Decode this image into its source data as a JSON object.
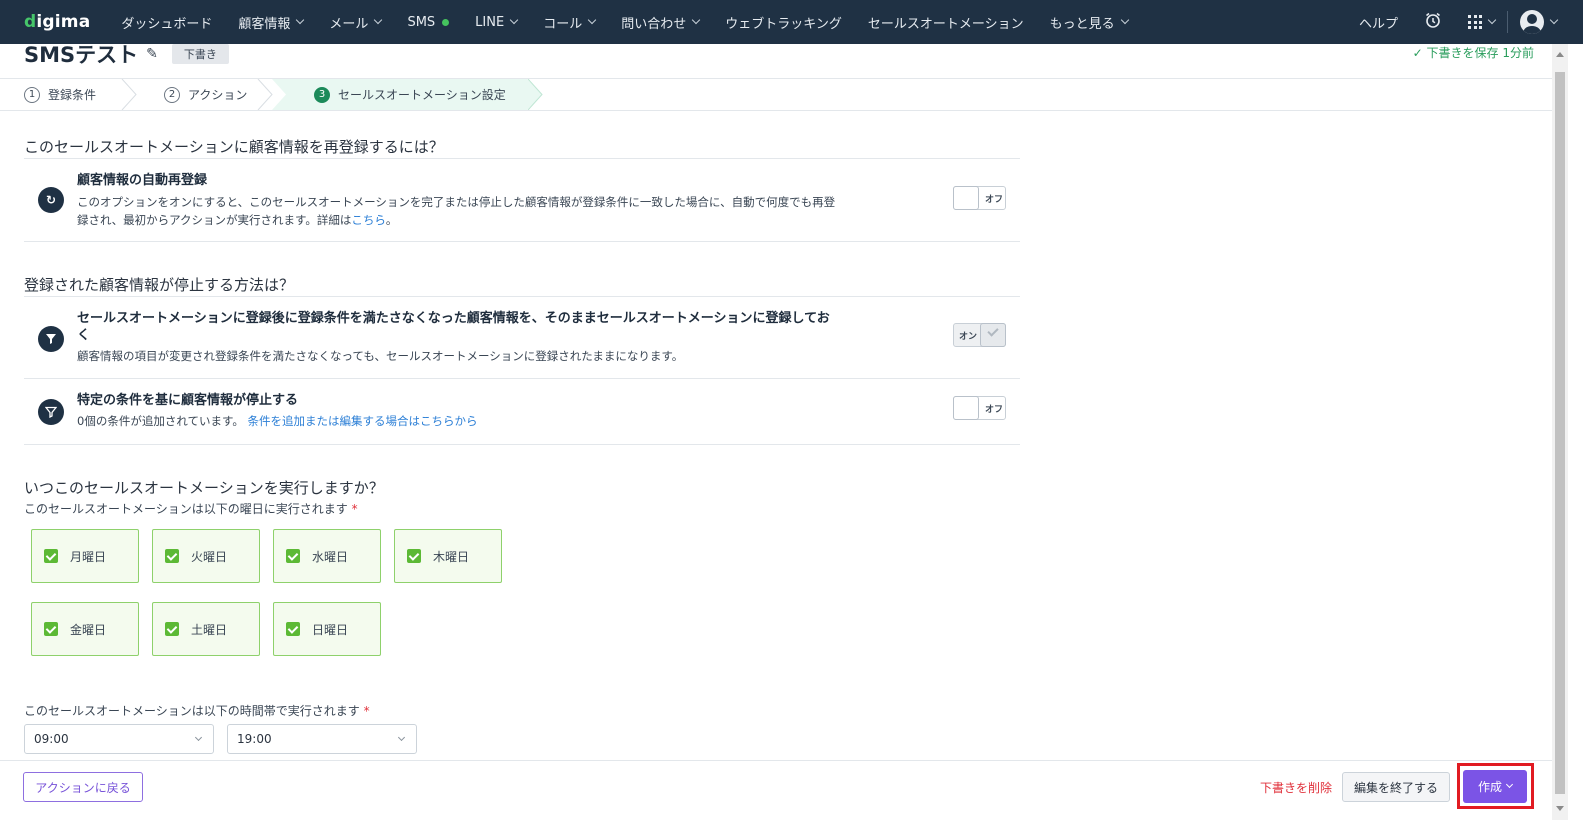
{
  "nav": {
    "logo_d": "d",
    "logo_rest": "igima",
    "items": [
      "ダッシュボード",
      "顧客情報",
      "メール",
      "SMS",
      "LINE",
      "コール",
      "問い合わせ",
      "ウェブトラッキング",
      "セールスオートメーション",
      "もっと見る"
    ],
    "help": "ヘルプ"
  },
  "header": {
    "title": "SMSテスト",
    "badge": "下書き",
    "saved": "✓ 下書きを保存 1分前"
  },
  "steps": [
    {
      "num": "1",
      "label": "登録条件"
    },
    {
      "num": "2",
      "label": "アクション"
    },
    {
      "num": "3",
      "label": "セールスオートメーション設定"
    }
  ],
  "sections": {
    "re_register": {
      "heading": "このセールスオートメーションに顧客情報を再登録するには？",
      "title": "顧客情報の自動再登録",
      "desc": "このオプションをオンにすると、このセールスオートメーションを完了または停止した顧客情報が登録条件に一致した場合に、自動で何度でも再登録され、最初からアクションが実行されます。詳細は",
      "link": "こちら",
      "desc_end": "。",
      "toggle": "オフ"
    },
    "stop": {
      "heading": "登録された顧客情報が停止する方法は？",
      "opt1_title": "セールスオートメーションに登録後に登録条件を満たさなくなった顧客情報を、そのままセールスオートメーションに登録しておく",
      "opt1_desc": "顧客情報の項目が変更され登録条件を満たさなくなっても、セールスオートメーションに登録されたままになります。",
      "opt1_toggle": "オン",
      "opt2_title": "特定の条件を基に顧客情報が停止する",
      "opt2_desc": "0個の条件が追加されています。",
      "opt2_link": "条件を追加または編集する場合はこちらから",
      "opt2_toggle": "オフ"
    },
    "schedule": {
      "heading": "いつこのセールスオートメーションを実行しますか？",
      "days_label": "このセールスオートメーションは以下の曜日に実行されます",
      "required": "*",
      "days": [
        "月曜日",
        "火曜日",
        "水曜日",
        "木曜日",
        "金曜日",
        "土曜日",
        "日曜日"
      ],
      "time_label": "このセールスオートメーションは以下の時間帯で実行されます",
      "start": "09:00",
      "end": "19:00"
    }
  },
  "footer": {
    "back": "アクションに戻る",
    "delete_draft": "下書きを削除",
    "end_edit": "編集を終了する",
    "create": "作成"
  },
  "colors": {
    "nav_bg": "#1f3144",
    "accent_purple": "#7b54e6",
    "step_active": "#1c8a5a",
    "day_border": "#8ed16b",
    "highlight": "#e11b22"
  }
}
